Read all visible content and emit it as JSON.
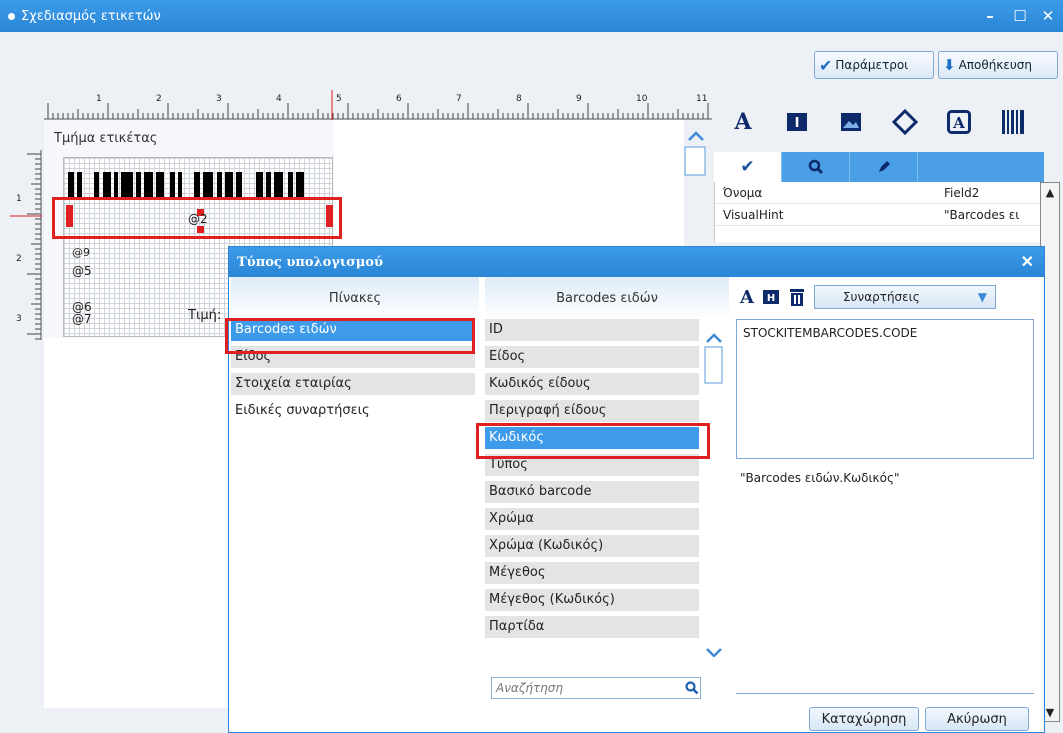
{
  "window": {
    "title": "Σχεδιασμός ετικετών"
  },
  "toolbar": {
    "params_label": "Παράμετροι",
    "save_label": "Αποθήκευση"
  },
  "ruler": {
    "numbers": [
      "1",
      "2",
      "3",
      "4",
      "5",
      "6",
      "7",
      "8",
      "9",
      "10",
      "11"
    ],
    "left_numbers": [
      "1",
      "2",
      "3"
    ]
  },
  "designer": {
    "section_label": "Τμήμα ετικέτας",
    "fields": {
      "f2": "@2",
      "f9": "@9",
      "f5": "@5",
      "f6": "@6",
      "f7": "@7",
      "price_label": "Τιμή:"
    }
  },
  "properties": {
    "rows": [
      {
        "name": "Όνομα",
        "value": "Field2"
      },
      {
        "name": "VisualHint",
        "value": "\"Barcodes ει"
      }
    ]
  },
  "dialog": {
    "title": "Τύπος υπολογισμού",
    "tables_header": "Πίνακες",
    "fields_header": "Barcodes ειδών",
    "tables": [
      "Barcodes ειδών",
      "Είδος",
      "Στοιχεία εταιρίας",
      "Ειδικές συναρτήσεις"
    ],
    "fields": [
      "ID",
      "Είδος",
      "Κωδικός είδους",
      "Περιγραφή είδους",
      "Κωδικός",
      "Τύπος",
      "Βασικό barcode",
      "Χρώμα",
      "Χρώμα (Κωδικός)",
      "Μέγεθος",
      "Μέγεθος (Κωδικός)",
      "Παρτίδα"
    ],
    "search_placeholder": "Αναζήτηση",
    "functions_label": "Συναρτήσεις",
    "expression": "STOCKITEMBARCODES.CODE",
    "expression_preview": "\"Barcodes ειδών.Κωδικός\"",
    "ok_label": "Καταχώρηση",
    "cancel_label": "Ακύρωση"
  },
  "colors": {
    "accent": "#2a86d6",
    "selection": "#3d9be9",
    "highlight": "#e02020"
  }
}
